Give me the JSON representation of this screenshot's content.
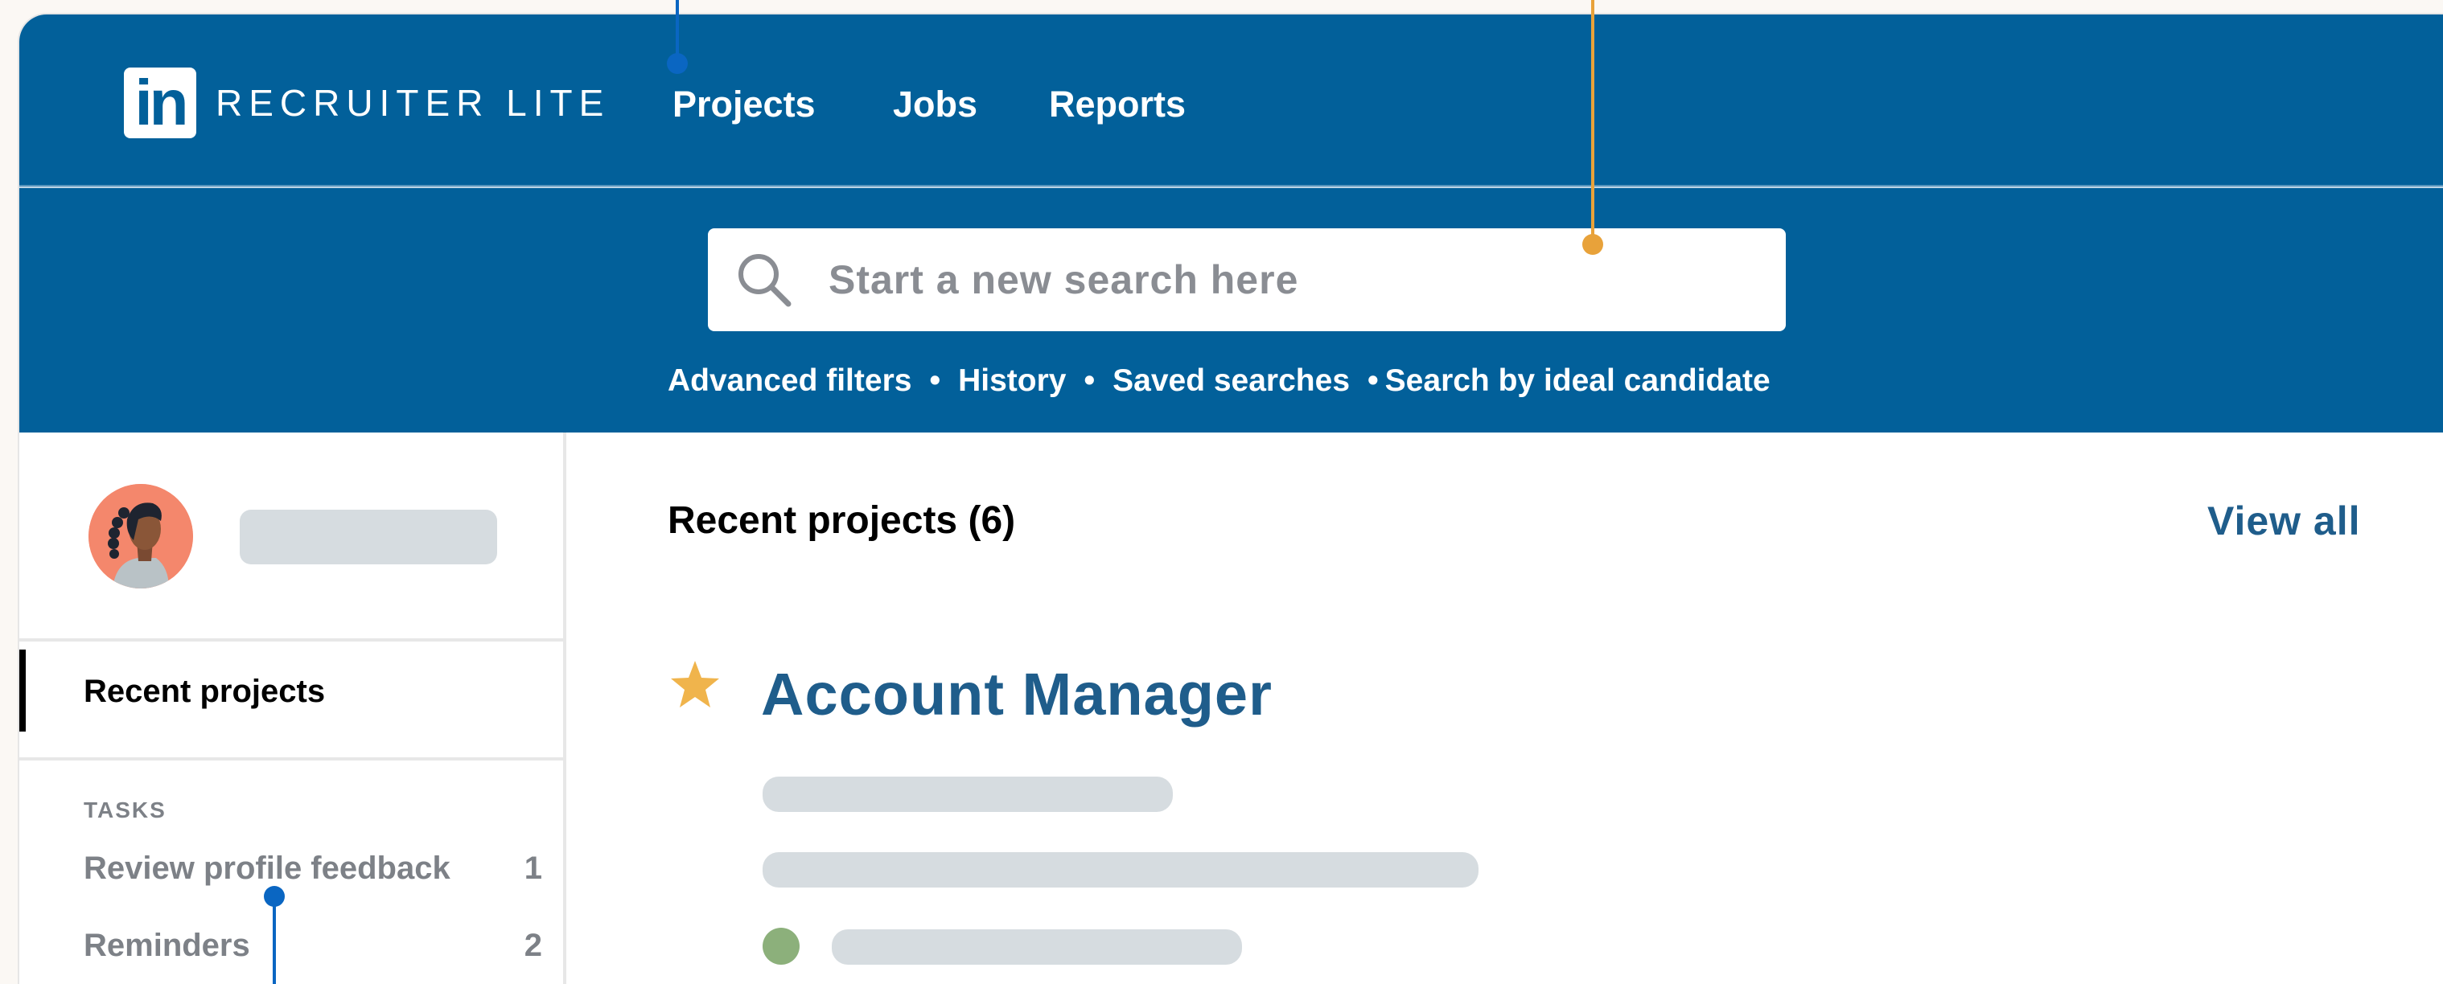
{
  "app": {
    "logo_text": "in",
    "brand_name": "RECRUITER LITE"
  },
  "nav": {
    "items": [
      {
        "label": "Projects"
      },
      {
        "label": "Jobs"
      },
      {
        "label": "Reports"
      }
    ]
  },
  "search": {
    "placeholder": "Start a new search here",
    "icon": "search-icon",
    "links": [
      {
        "label": "Advanced filters"
      },
      {
        "label": "History"
      },
      {
        "label": "Saved searches"
      },
      {
        "label": "Search by ideal candidate"
      }
    ],
    "separator": "•"
  },
  "sidebar": {
    "recent_projects_label": "Recent projects",
    "tasks_heading": "TASKS",
    "tasks": [
      {
        "label": "Review profile feedback",
        "count": "1"
      },
      {
        "label": "Reminders",
        "count": "2"
      }
    ]
  },
  "main": {
    "section_title": "Recent projects (6)",
    "view_all_label": "View all",
    "project": {
      "title": "Account Manager",
      "starred": true
    }
  },
  "colors": {
    "brand_blue": "#02609a",
    "link_blue": "#1f5d8b",
    "star": "#f0b44c",
    "status_green": "#8cb07b",
    "callout_blue": "#0a66c2",
    "callout_orange": "#e8a23a",
    "skeleton": "#d6dce0"
  }
}
